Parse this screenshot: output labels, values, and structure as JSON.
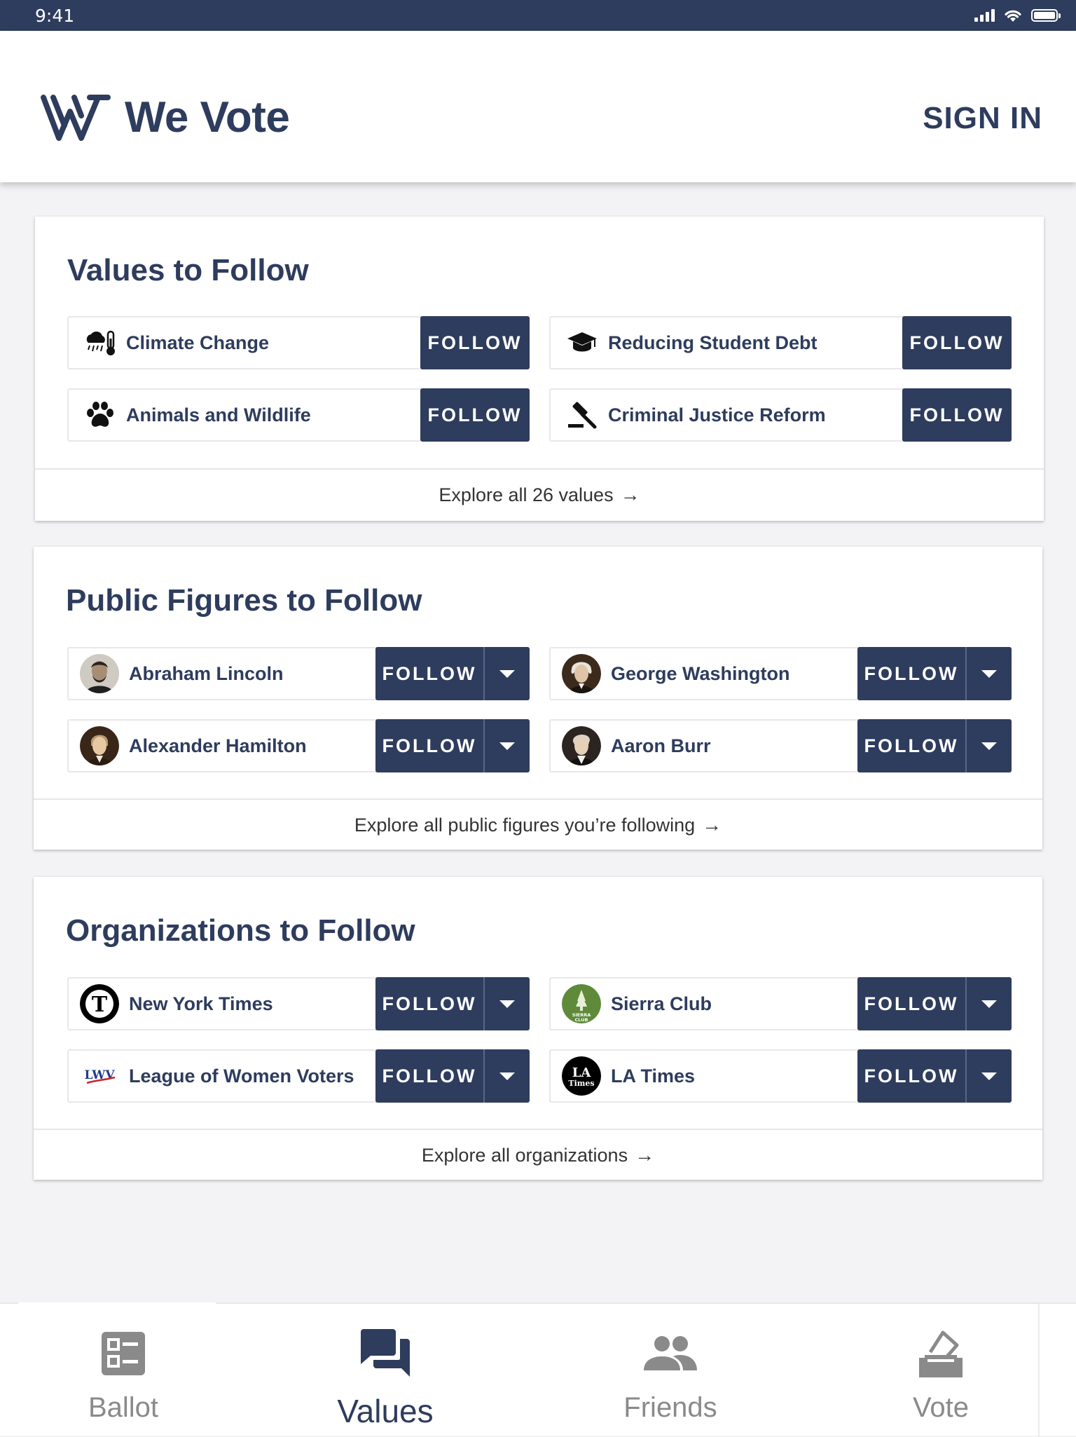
{
  "status_bar": {
    "time": "9:41"
  },
  "header": {
    "app_name": "We Vote",
    "sign_in": "SIGN IN"
  },
  "values_card": {
    "title": "Values to Follow",
    "items": [
      {
        "label": "Climate Change",
        "icon": "climate-icon",
        "button": "FOLLOW"
      },
      {
        "label": "Reducing Student Debt",
        "icon": "graduation-cap-icon",
        "button": "FOLLOW"
      },
      {
        "label": "Animals and Wildlife",
        "icon": "paw-icon",
        "button": "FOLLOW"
      },
      {
        "label": "Criminal Justice Reform",
        "icon": "gavel-icon",
        "button": "FOLLOW"
      }
    ],
    "explore": "Explore all 26 values"
  },
  "figures_card": {
    "title": "Public Figures to Follow",
    "items": [
      {
        "label": "Abraham Lincoln",
        "button": "FOLLOW"
      },
      {
        "label": "George Washington",
        "button": "FOLLOW"
      },
      {
        "label": "Alexander Hamilton",
        "button": "FOLLOW"
      },
      {
        "label": "Aaron Burr",
        "button": "FOLLOW"
      }
    ],
    "explore": "Explore all public figures you’re following"
  },
  "orgs_card": {
    "title": "Organizations to Follow",
    "items": [
      {
        "label": "New York Times",
        "logo_text": "T",
        "button": "FOLLOW"
      },
      {
        "label": "Sierra Club",
        "logo_text": "SIERRA CLUB",
        "button": "FOLLOW"
      },
      {
        "label": "League of Women Voters",
        "logo_text": "LWV",
        "button": "FOLLOW"
      },
      {
        "label": "LA Times",
        "logo_text": "LA Times",
        "button": "FOLLOW"
      }
    ],
    "explore": "Explore all organizations"
  },
  "bottom_nav": {
    "items": [
      {
        "label": "Ballot",
        "icon": "ballot-icon"
      },
      {
        "label": "Values",
        "icon": "chat-icon",
        "active": true
      },
      {
        "label": "Friends",
        "icon": "friends-icon"
      },
      {
        "label": "Vote",
        "icon": "vote-box-icon"
      }
    ]
  },
  "colors": {
    "brand_navy": "#2e3c5d",
    "background": "#f3f3f5",
    "muted": "#8a8a8a"
  }
}
